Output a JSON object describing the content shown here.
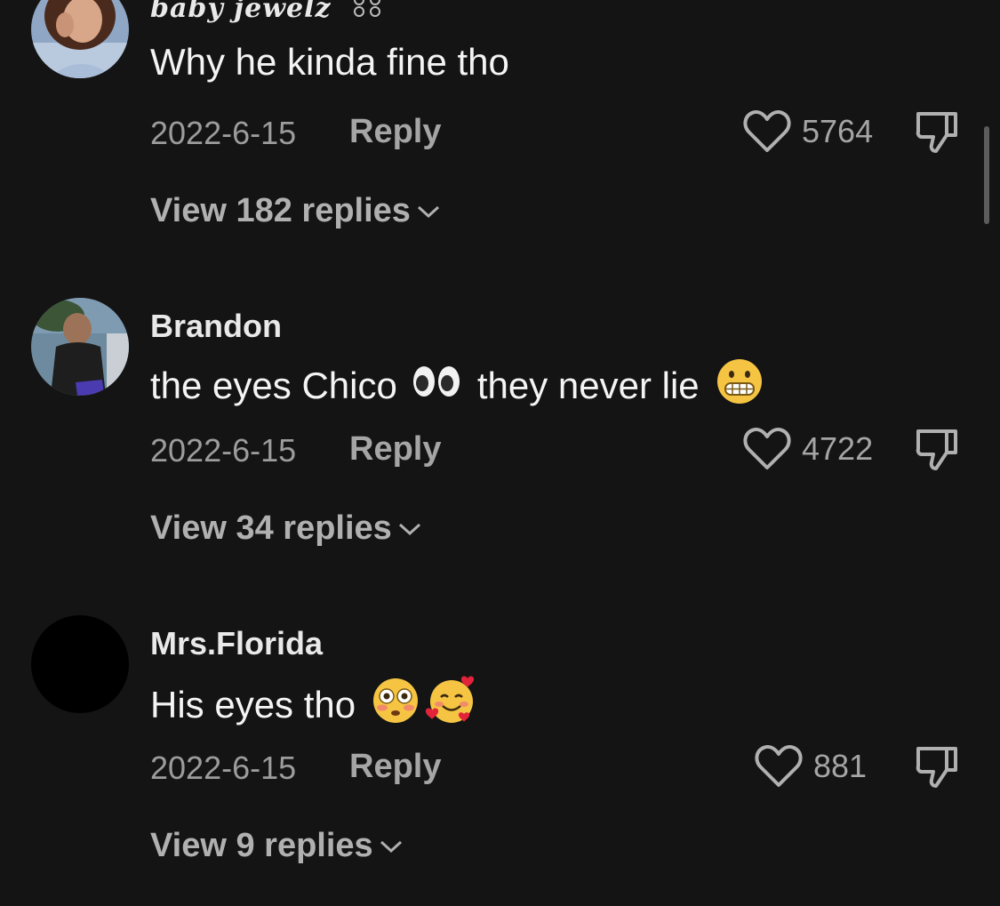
{
  "comments": [
    {
      "username": "baby jewelz",
      "text": "Why he kinda fine tho",
      "date": "2022-6-15",
      "reply_label": "Reply",
      "likes": "5764",
      "view_replies": "View 182 replies"
    },
    {
      "username": "Brandon",
      "text_part1": "the eyes Chico",
      "text_part2": "they never lie",
      "emojis": [
        "eyes",
        "grimacing-face"
      ],
      "date": "2022-6-15",
      "reply_label": "Reply",
      "likes": "4722",
      "view_replies": "View 34 replies"
    },
    {
      "username": "Mrs.Florida",
      "text": "His eyes tho",
      "emojis": [
        "flushed-face",
        "smiling-face-with-hearts"
      ],
      "date": "2022-6-15",
      "reply_label": "Reply",
      "likes": "881",
      "view_replies": "View 9 replies"
    }
  ],
  "icons": {
    "like": "heart-outline-icon",
    "dislike": "thumbs-down-icon",
    "expand": "chevron-down-icon"
  },
  "colors": {
    "background": "#141414",
    "primary_text": "#f4f4f4",
    "secondary_text": "#9c9c9c"
  }
}
